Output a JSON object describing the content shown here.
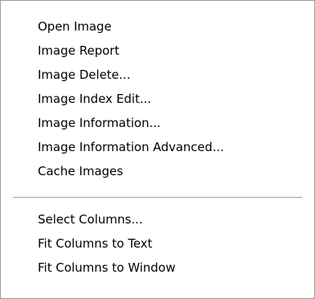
{
  "menu": {
    "group1": [
      {
        "label": "Open Image"
      },
      {
        "label": "Image Report"
      },
      {
        "label": "Image Delete..."
      },
      {
        "label": "Image Index Edit..."
      },
      {
        "label": "Image Information..."
      },
      {
        "label": "Image Information Advanced..."
      },
      {
        "label": "Cache Images"
      }
    ],
    "group2": [
      {
        "label": "Select Columns..."
      },
      {
        "label": "Fit Columns to Text"
      },
      {
        "label": "Fit Columns to Window"
      }
    ]
  }
}
